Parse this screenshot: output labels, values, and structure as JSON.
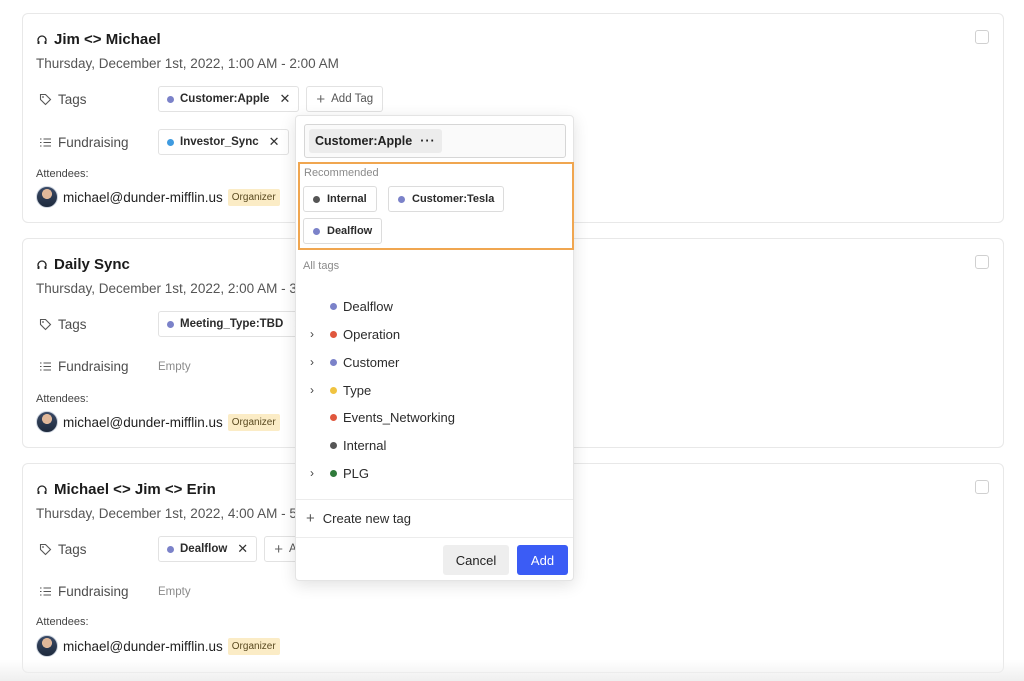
{
  "colors": {
    "accent": "#3b5cf5",
    "highlight_border": "#f0a650",
    "organizer_badge": "#fbecc6"
  },
  "labels": {
    "tags": "Tags",
    "fundraising": "Fundraising",
    "attendees": "Attendees:",
    "add_tag": "Add Tag",
    "empty": "Empty",
    "organizer": "Organizer"
  },
  "meetings": [
    {
      "title": "Jim <> Michael",
      "date": "Thursday, December 1st, 2022, 1:00 AM - 2:00 AM",
      "tag": {
        "label": "Customer:Apple",
        "color": "#7b82c9"
      },
      "fundraising": {
        "label": "Investor_Sync",
        "color": "#3f9be0"
      },
      "attendee": "michael@dunder-mifflin.us"
    },
    {
      "title": "Daily Sync",
      "date": "Thursday, December 1st, 2022, 2:00 AM - 3",
      "tag": {
        "label": "Meeting_Type:TBD",
        "color": "#7b82c9"
      },
      "fundraising": null,
      "attendee": "michael@dunder-mifflin.us"
    },
    {
      "title": "Michael <> Jim <> Erin",
      "date": "Thursday, December 1st, 2022, 4:00 AM - 5",
      "tag": {
        "label": "Dealflow",
        "color": "#7b82c9"
      },
      "fundraising": null,
      "attendee": "michael@dunder-mifflin.us"
    }
  ],
  "popover": {
    "selected": "Customer:Apple",
    "more": "···",
    "recommended_label": "Recommended",
    "recommended": [
      {
        "label": "Internal",
        "color": "#555555"
      },
      {
        "label": "Customer:Tesla",
        "color": "#7b82c9"
      },
      {
        "label": "Dealflow",
        "color": "#7b82c9"
      }
    ],
    "all_tags_label": "All tags",
    "all_tags": [
      {
        "label": "Dealflow",
        "color": "#7b82c9",
        "expandable": false
      },
      {
        "label": "Operation",
        "color": "#e0573d",
        "expandable": true
      },
      {
        "label": "Customer",
        "color": "#7b82c9",
        "expandable": true
      },
      {
        "label": "Type",
        "color": "#f0c340",
        "expandable": true
      },
      {
        "label": "Events_Networking",
        "color": "#e0573d",
        "expandable": false
      },
      {
        "label": "Internal",
        "color": "#555555",
        "expandable": false
      },
      {
        "label": "PLG",
        "color": "#2f7a3a",
        "expandable": true
      }
    ],
    "create_new": "Create new tag",
    "cancel": "Cancel",
    "add": "Add"
  }
}
